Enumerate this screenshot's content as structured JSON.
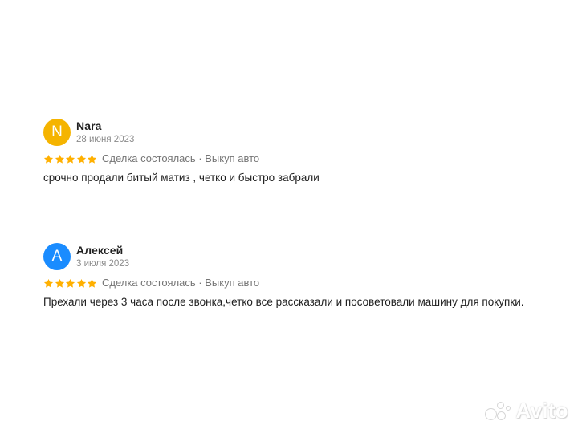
{
  "reviews": [
    {
      "avatar_letter": "N",
      "avatar_color": "#F5B400",
      "name": "Nara",
      "date": "28 июня 2023",
      "rating": 5,
      "meta": "Сделка состоялась · Выкуп авто",
      "text": "срочно продали битый матиз , четко и быстро забрали"
    },
    {
      "avatar_letter": "А",
      "avatar_color": "#1A8CFF",
      "name": "Алексей",
      "date": "3 июля 2023",
      "rating": 5,
      "meta": "Сделка состоялась · Выкуп авто",
      "text": "Прехали через 3 часа после звонка,четко все рассказали и посоветовали машину для покупки."
    }
  ],
  "star_color": "#FFB000",
  "watermark": {
    "text": "Avito"
  }
}
